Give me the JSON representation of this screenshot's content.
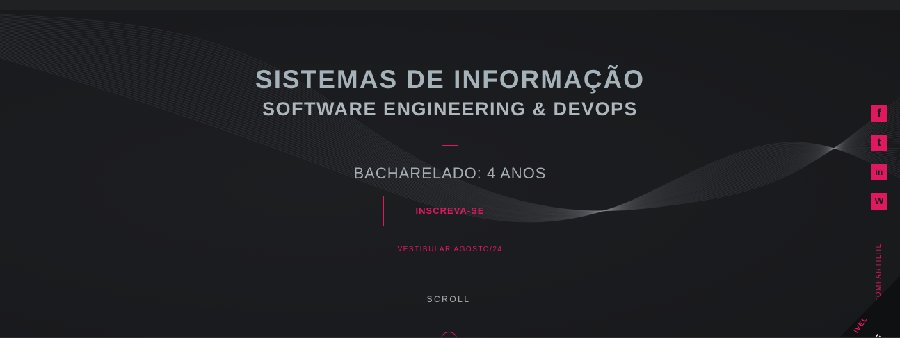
{
  "hero": {
    "title": "SISTEMAS DE INFORMAÇÃO",
    "subtitle": "SOFTWARE ENGINEERING & DEVOPS",
    "degree": "BACHARELADO: 4 ANOS",
    "cta_label": "INSCREVA-SE",
    "vestibular": "VESTIBULAR AGOSTO/24"
  },
  "scroll": {
    "label": "SCROLL"
  },
  "social": {
    "share_label": "COMPARTILHE",
    "items": [
      {
        "name": "facebook",
        "glyph": "f"
      },
      {
        "name": "twitter",
        "glyph": "t"
      },
      {
        "name": "linkedin",
        "glyph": "in"
      },
      {
        "name": "whatsapp",
        "glyph": "w"
      }
    ]
  },
  "corner_badge": {
    "line1": "ÍVEL",
    "line2": "E"
  },
  "colors": {
    "accent": "#e0195f",
    "background": "#1c1d20",
    "title_text": "#a6b2b9"
  }
}
